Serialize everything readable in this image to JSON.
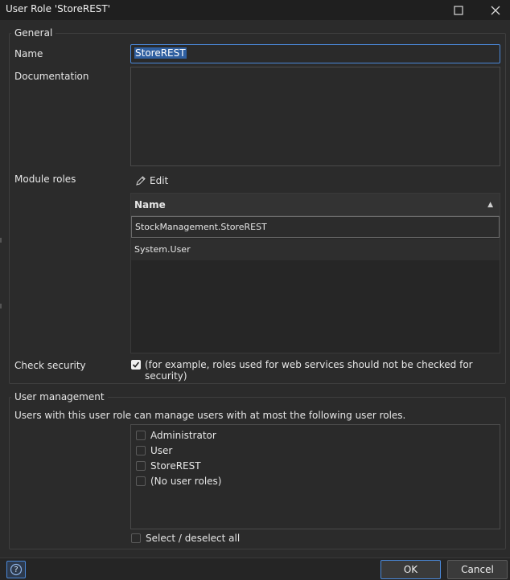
{
  "window": {
    "title": "User Role 'StoreREST'",
    "maximize_icon": "maximize-icon",
    "close_icon": "close-icon"
  },
  "general": {
    "legend": "General",
    "name_label": "Name",
    "name_value": "StoreREST",
    "documentation_label": "Documentation",
    "documentation_value": "",
    "module_roles_label": "Module roles",
    "edit_label": "Edit",
    "grid": {
      "column_header": "Name",
      "rows": [
        "StockManagement.StoreREST",
        "System.User"
      ]
    },
    "check_security_label": "Check security",
    "check_security_checked": true,
    "check_security_text": "(for example, roles used for web services should not be checked for security)"
  },
  "user_management": {
    "legend": "User management",
    "description": "Users with this user role can manage users with at most the following user roles.",
    "roles": [
      {
        "label": "Administrator",
        "checked": false
      },
      {
        "label": "User",
        "checked": false
      },
      {
        "label": "StoreREST",
        "checked": false
      },
      {
        "label": "(No user roles)",
        "checked": false
      }
    ],
    "select_all_label": "Select / deselect all"
  },
  "footer": {
    "help_label": "?",
    "ok_label": "OK",
    "cancel_label": "Cancel"
  },
  "colors": {
    "accent": "#4a88d8",
    "background": "#2b2b2b",
    "titlebar": "#1f1f1f"
  }
}
